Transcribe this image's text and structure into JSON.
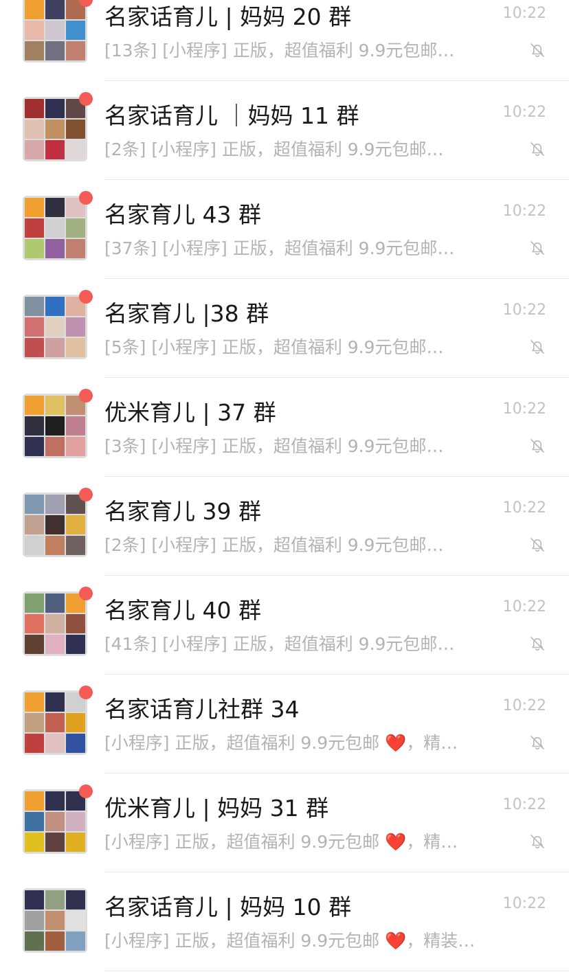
{
  "chats": [
    {
      "name": "名家话育儿 | 妈妈 20 群",
      "preview": "[13条] [小程序] 正版，超值福利 9.9元包邮…",
      "time": "10:22",
      "unread": true,
      "muted": true,
      "avatar_colors": [
        "#f0a030",
        "#404060",
        "#b06a50",
        "#e8b8a8",
        "#d0c8d0",
        "#4090d0",
        "#a08060",
        "#707080",
        "#c08070"
      ]
    },
    {
      "name": "名家话育儿 ｜妈妈 11 群",
      "preview": "[2条] [小程序] 正版，超值福利 9.9元包邮…",
      "time": "10:22",
      "unread": true,
      "muted": true,
      "avatar_colors": [
        "#a03030",
        "#303050",
        "#604848",
        "#e0c0b0",
        "#c09060",
        "#805030",
        "#d8a8a8",
        "#c03040",
        "#e0d8d8"
      ]
    },
    {
      "name": "名家育儿 43 群",
      "preview": "[37条] [小程序] 正版，超值福利 9.9元包邮…",
      "time": "10:22",
      "unread": true,
      "muted": true,
      "avatar_colors": [
        "#f0a030",
        "#303040",
        "#e0c0c0",
        "#c04040",
        "#d0d0d0",
        "#a0b080",
        "#b0c870",
        "#9060a0",
        "#c08070"
      ]
    },
    {
      "name": "名家育儿 |38 群",
      "preview": "[5条] [小程序] 正版，超值福利 9.9元包邮…",
      "time": "10:22",
      "unread": true,
      "muted": true,
      "avatar_colors": [
        "#8090a0",
        "#3070c0",
        "#e0b0a0",
        "#d07070",
        "#e0d0c0",
        "#c090b0",
        "#c05050",
        "#d0a0a0",
        "#e0c0a0"
      ]
    },
    {
      "name": "优米育儿 | 37 群",
      "preview": "[3条] [小程序] 正版，超值福利 9.9元包邮…",
      "time": "10:22",
      "unread": true,
      "muted": true,
      "avatar_colors": [
        "#f0a030",
        "#e0c060",
        "#c09070",
        "#303040",
        "#202020",
        "#c08090",
        "#303050",
        "#c07060",
        "#e0a0a0"
      ]
    },
    {
      "name": "名家育儿 39 群",
      "preview": "[2条] [小程序] 正版，超值福利 9.9元包邮…",
      "time": "10:22",
      "unread": true,
      "muted": true,
      "avatar_colors": [
        "#8098b0",
        "#a0a0b0",
        "#605050",
        "#c0a090",
        "#403030",
        "#e0b040",
        "#d0d0d0",
        "#c08060",
        "#706060"
      ]
    },
    {
      "name": "名家育儿 40 群",
      "preview": "[41条] [小程序] 正版，超值福利 9.9元包邮…",
      "time": "10:22",
      "unread": true,
      "muted": true,
      "avatar_colors": [
        "#80a070",
        "#506080",
        "#f0a030",
        "#e07060",
        "#d0b0a0",
        "#905040",
        "#604030",
        "#e0b0c0",
        "#303050"
      ]
    },
    {
      "name": "名家话育儿社群 34",
      "preview": "[小程序] 正版，超值福利 9.9元包邮 ❤️，精…",
      "time": "10:22",
      "unread": true,
      "muted": true,
      "avatar_colors": [
        "#f0a030",
        "#303050",
        "#d0d0d0",
        "#c0a080",
        "#c06050",
        "#e0a020",
        "#c04040",
        "#e0c0c0",
        "#3050a0"
      ]
    },
    {
      "name": "优米育儿 | 妈妈 31 群",
      "preview": "[小程序] 正版，超值福利 9.9元包邮 ❤️，精…",
      "time": "10:22",
      "unread": true,
      "muted": true,
      "avatar_colors": [
        "#f0a030",
        "#303050",
        "#303050",
        "#4070a0",
        "#c09080",
        "#d0b0c0",
        "#e0c020",
        "#604040",
        "#e0b020"
      ]
    },
    {
      "name": "名家话育儿 | 妈妈 10 群",
      "preview": "[小程序] 正版，超值福利 9.9元包邮 ❤️，精装…",
      "time": "10:22",
      "unread": false,
      "muted": false,
      "avatar_colors": [
        "#303050",
        "#90a080",
        "#303050",
        "#a0a0a0",
        "#c09070",
        "#e0e0e0",
        "#607050",
        "#a06040",
        "#80a0c0"
      ]
    }
  ],
  "colors": {
    "unread_dot": "#f15c55",
    "name_text": "#191919",
    "secondary_text": "#b3b3b3",
    "time_text": "#c2c2c2",
    "divider": "#e5e5e5"
  },
  "icons": {
    "mute": "bell-slash-icon",
    "unread": "red-dot-badge"
  }
}
